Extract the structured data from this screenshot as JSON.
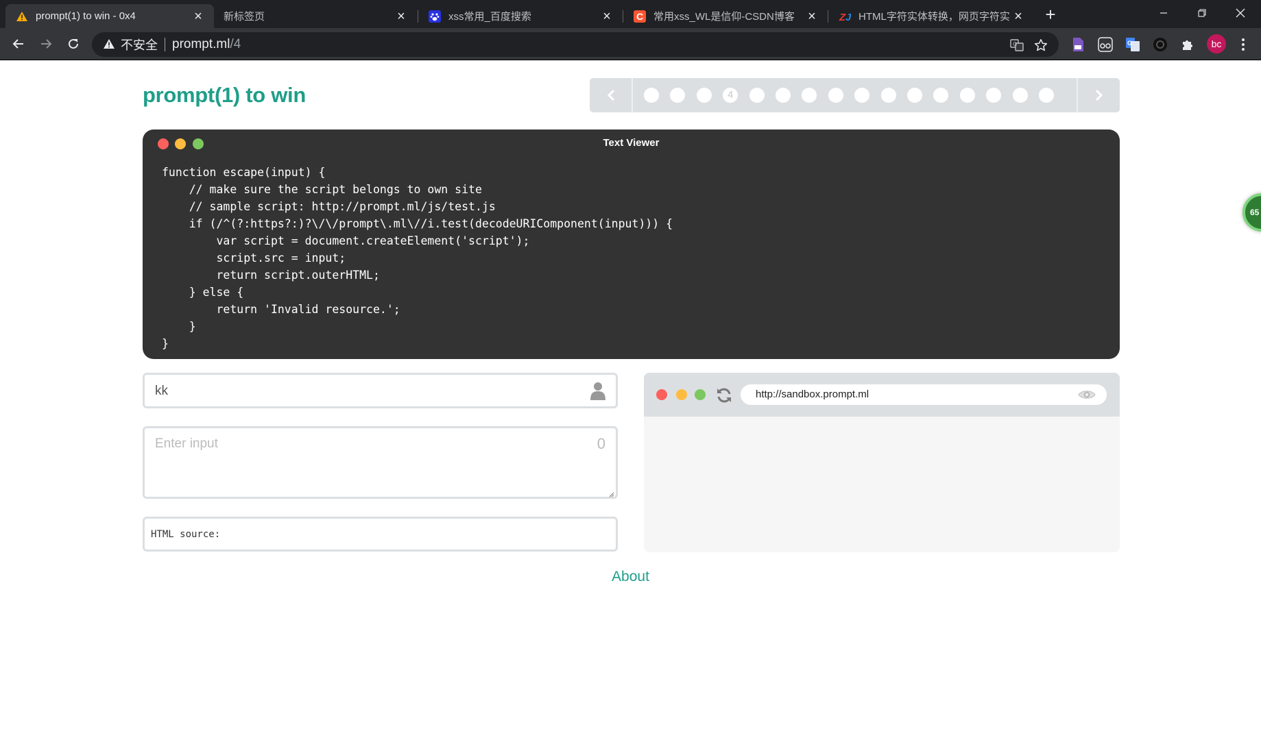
{
  "browser": {
    "tabs": [
      {
        "title": "prompt(1) to win - 0x4",
        "icon": "warning-icon",
        "active": true
      },
      {
        "title": "新标签页",
        "icon": "",
        "active": false
      },
      {
        "title": "xss常用_百度搜索",
        "icon": "baidu-paw-icon",
        "active": false
      },
      {
        "title": "常用xss_WL是信仰-CSDN博客",
        "icon": "csdn-c-icon",
        "active": false
      },
      {
        "title": "HTML字符实体转换，网页字符实",
        "icon": "zj-logo-icon",
        "active": false
      }
    ],
    "insecure_label": "不安全",
    "url_host": "prompt.ml",
    "url_path": "/4",
    "avatar_initials": "bc"
  },
  "page": {
    "title": "prompt(1) to win",
    "pager": {
      "total": 16,
      "current": 4,
      "current_label": "4"
    },
    "viewer": {
      "title": "Text Viewer",
      "code": "function escape(input) {\n    // make sure the script belongs to own site\n    // sample script: http://prompt.ml/js/test.js\n    if (/^(?:https?:)?\\/\\/prompt\\.ml\\//i.test(decodeURIComponent(input))) {\n        var script = document.createElement('script');\n        script.src = input;\n        return script.outerHTML;\n    } else {\n        return 'Invalid resource.';\n    }\n}"
    },
    "name_field": {
      "value": "kk"
    },
    "input": {
      "placeholder": "Enter input",
      "char_count": "0"
    },
    "html_source_label": "HTML source:",
    "sandbox": {
      "url": "http://sandbox.prompt.ml"
    },
    "about_link": "About",
    "side_widget_text": "65"
  },
  "colors": {
    "accent": "#1f9e89",
    "viewer_bg": "#333333",
    "dot_red": "#fc605c",
    "dot_yellow": "#fdbc40",
    "dot_green": "#7cc75f"
  }
}
